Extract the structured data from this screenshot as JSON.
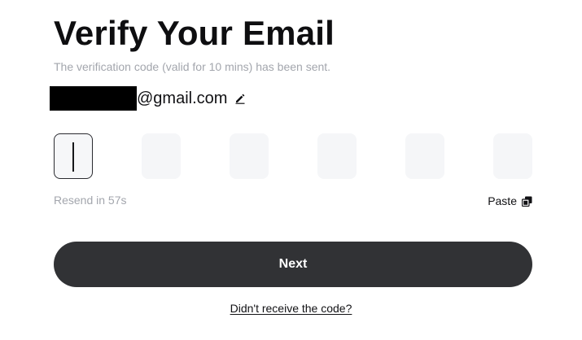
{
  "header": {
    "title": "Verify Your Email",
    "subtitle": "The verification code (valid for 10 mins) has been sent."
  },
  "email": {
    "domain": "@gmail.com",
    "edit_icon": "pencil-icon"
  },
  "otp": {
    "length": 6,
    "values": [
      "",
      "",
      "",
      "",
      "",
      ""
    ],
    "active_index": 0
  },
  "actions": {
    "resend_text": "Resend in 57s",
    "paste_label": "Paste",
    "paste_icon": "clipboard-icon",
    "next_label": "Next",
    "no_code_link": "Didn't receive the code?"
  },
  "colors": {
    "primary_button": "#313235",
    "muted_text": "#a3a6ad",
    "input_bg": "#f5f6f8"
  }
}
